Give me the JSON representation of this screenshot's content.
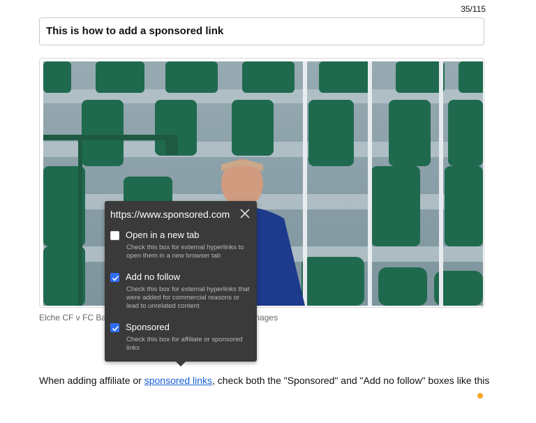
{
  "counter": "35/115",
  "title": "This is how to add a sponsored link",
  "caption": "Elche CF v FC Bar",
  "caption_end": "nez/Getty Images",
  "popover": {
    "url": "https://www.sponsored.com",
    "close_icon": "close-icon",
    "options": [
      {
        "label": "Open in a new tab",
        "help": "Check this box for external hyperlinks to open them in a new browser tab",
        "checked": false
      },
      {
        "label": "Add no follow",
        "help": "Check this box for external hyperlinks that were added for commercial reasons or lead to unrelated content",
        "checked": true
      },
      {
        "label": "Sponsored",
        "help": "Check this box for affiliate or sponsored links",
        "checked": true
      }
    ]
  },
  "body": {
    "before": "When adding affiliate or ",
    "link": "sponsored links",
    "after": ", check both the \"Sponsored\" and \"Add no follow\" boxes like this"
  },
  "colors": {
    "accent": "#2f6ef5",
    "popover_bg": "#3a3a3a",
    "link": "#1a5fd6",
    "dot": "#f6a623"
  }
}
